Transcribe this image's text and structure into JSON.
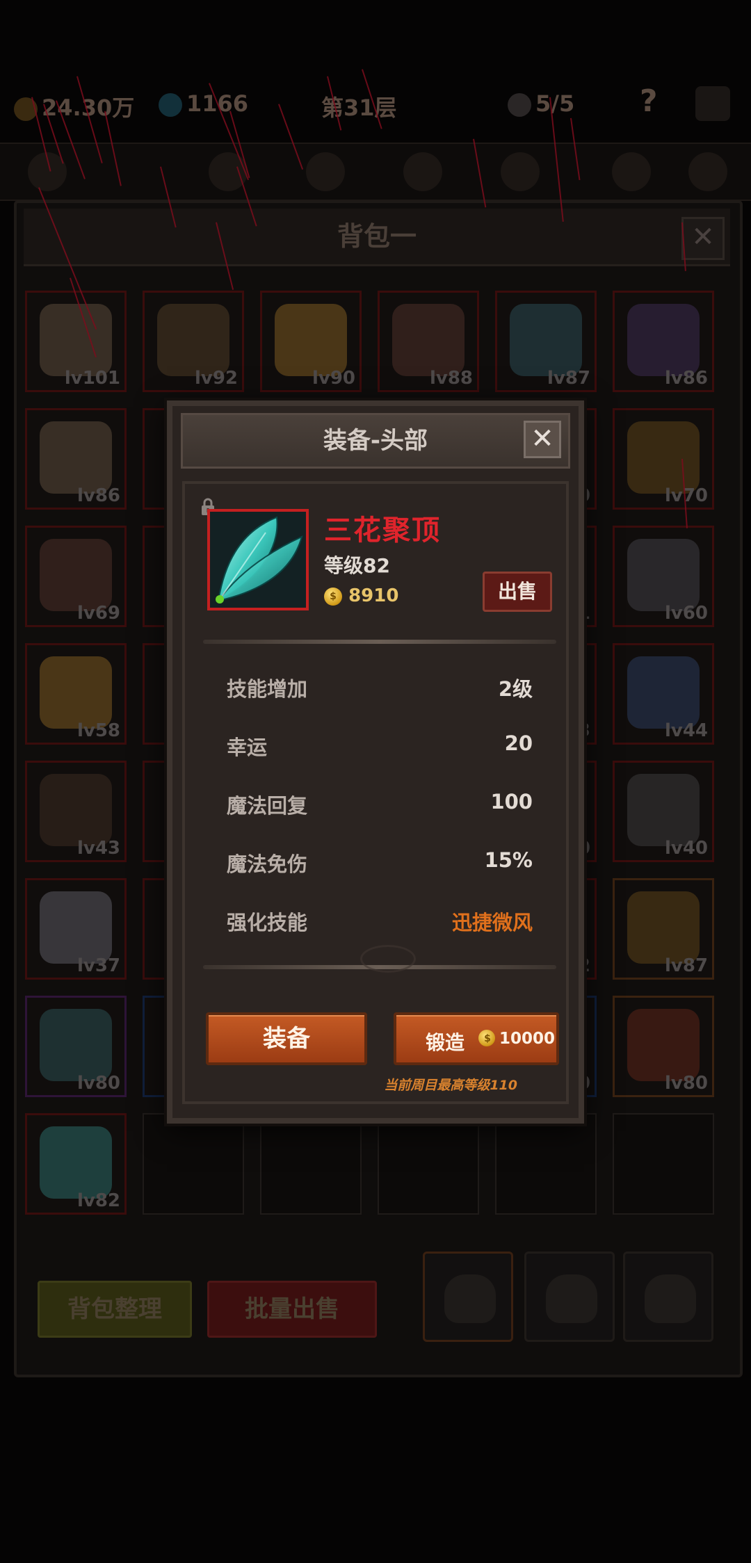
{
  "top_bar": {
    "gold": "24.30万",
    "gems": "1166",
    "floor": "第31层",
    "kills": "5/5",
    "help": "?"
  },
  "bag": {
    "title": "背包一",
    "close_icon": "close-icon",
    "items": [
      {
        "level": "lv101",
        "icon": "helmet-icon",
        "rarity": "red"
      },
      {
        "level": "lv92",
        "icon": "crescent-blade-icon",
        "rarity": "red"
      },
      {
        "level": "lv90",
        "icon": "seed-pod-icon",
        "rarity": "red"
      },
      {
        "level": "lv88",
        "icon": "trident-icon",
        "rarity": "red"
      },
      {
        "level": "lv87",
        "icon": "axe-icon",
        "rarity": "red"
      },
      {
        "level": "lv86",
        "icon": "gun-icon",
        "rarity": "red"
      },
      {
        "level": "lv86",
        "icon": "helmet-icon",
        "rarity": "red"
      },
      {
        "level": "",
        "icon": "hidden",
        "rarity": "red"
      },
      {
        "level": "",
        "icon": "hidden",
        "rarity": "red"
      },
      {
        "level": "",
        "icon": "hidden",
        "rarity": "red"
      },
      {
        "level": "0",
        "icon": "hidden",
        "rarity": "red"
      },
      {
        "level": "lv70",
        "icon": "mane-helm-icon",
        "rarity": "red"
      },
      {
        "level": "lv69",
        "icon": "trident-icon",
        "rarity": "red"
      },
      {
        "level": "",
        "icon": "hidden",
        "rarity": "red"
      },
      {
        "level": "",
        "icon": "hidden",
        "rarity": "red"
      },
      {
        "level": "",
        "icon": "hidden",
        "rarity": "red"
      },
      {
        "level": "1",
        "icon": "hidden",
        "rarity": "red"
      },
      {
        "level": "lv60",
        "icon": "armor-icon",
        "rarity": "red"
      },
      {
        "level": "lv58",
        "icon": "seed-pod-icon",
        "rarity": "red"
      },
      {
        "level": "",
        "icon": "hidden",
        "rarity": "red"
      },
      {
        "level": "",
        "icon": "hidden",
        "rarity": "red"
      },
      {
        "level": "",
        "icon": "hidden",
        "rarity": "red"
      },
      {
        "level": "3",
        "icon": "hidden",
        "rarity": "red"
      },
      {
        "level": "lv44",
        "icon": "sword-icon",
        "rarity": "red"
      },
      {
        "level": "lv43",
        "icon": "bow-icon",
        "rarity": "red"
      },
      {
        "level": "",
        "icon": "hidden",
        "rarity": "red"
      },
      {
        "level": "",
        "icon": "hidden",
        "rarity": "red"
      },
      {
        "level": "",
        "icon": "hidden",
        "rarity": "red"
      },
      {
        "level": "0",
        "icon": "hidden",
        "rarity": "red"
      },
      {
        "level": "lv40",
        "icon": "bracer-icon",
        "rarity": "red"
      },
      {
        "level": "lv37",
        "icon": "claw-blade-icon",
        "rarity": "red"
      },
      {
        "level": "",
        "icon": "hidden",
        "rarity": "red"
      },
      {
        "level": "",
        "icon": "hidden",
        "rarity": "red"
      },
      {
        "level": "",
        "icon": "hidden",
        "rarity": "red"
      },
      {
        "level": "2",
        "icon": "hidden",
        "rarity": "red"
      },
      {
        "level": "lv87",
        "icon": "mane-helm-icon",
        "rarity": "orange"
      },
      {
        "level": "lv80",
        "icon": "orb-icon",
        "rarity": "purple"
      },
      {
        "level": "",
        "icon": "hidden",
        "rarity": "blue"
      },
      {
        "level": "",
        "icon": "hidden",
        "rarity": "red"
      },
      {
        "level": "",
        "icon": "hidden",
        "rarity": "red"
      },
      {
        "level": "0",
        "icon": "hidden",
        "rarity": "blue"
      },
      {
        "level": "lv80",
        "icon": "mace-icon",
        "rarity": "orange"
      },
      {
        "level": "lv82",
        "icon": "crystal-wings-icon",
        "rarity": "red"
      },
      {
        "level": "",
        "icon": "empty",
        "rarity": "empty"
      },
      {
        "level": "",
        "icon": "empty",
        "rarity": "empty"
      },
      {
        "level": "",
        "icon": "empty",
        "rarity": "empty"
      },
      {
        "level": "",
        "icon": "empty",
        "rarity": "empty"
      },
      {
        "level": "",
        "icon": "empty",
        "rarity": "empty"
      }
    ],
    "sort_label": "背包整理",
    "batch_sell_label": "批量出售",
    "tabs": [
      "bag-1",
      "bag-2",
      "bag-3"
    ]
  },
  "modal": {
    "title": "装备-头部",
    "item": {
      "name": "三花聚顶",
      "level_text": "等级82",
      "price": "8910",
      "icon": "crystal-wings-icon",
      "locked": true
    },
    "sell_label": "出售",
    "stats": [
      {
        "label": "技能增加",
        "value": "2级"
      },
      {
        "label": "幸运",
        "value": "20"
      },
      {
        "label": "魔法回复",
        "value": "100"
      },
      {
        "label": "魔法免伤",
        "value": "15%"
      },
      {
        "label": "强化技能",
        "value": "迅捷微风",
        "highlight": true
      }
    ],
    "equip_label": "装备",
    "forge_label": "锻造",
    "forge_cost": "10000",
    "note": "当前周目最高等级110"
  },
  "colors": {
    "item_name": "#e0242c",
    "button": "#b04a1c",
    "highlight_stat": "#e0701c",
    "rain": "#7a0d1c"
  }
}
